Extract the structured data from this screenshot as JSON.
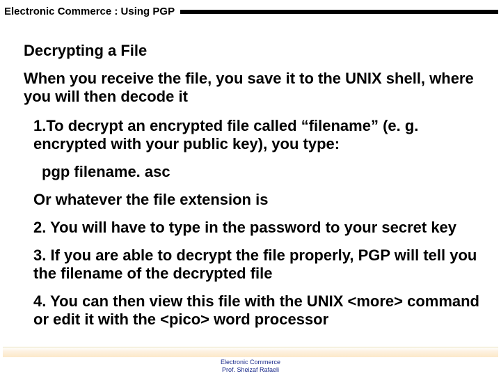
{
  "header": {
    "title": "Electronic Commerce :  Using PGP"
  },
  "body": {
    "heading": "Decrypting a File",
    "intro": "When you receive the file, you save it to the UNIX shell, where you will then decode it",
    "steps": [
      "1.To decrypt an encrypted file called “filename” (e. g. encrypted with your public key), you type:",
      "2. You will have to type in the password to your secret key",
      "3. If you are able to decrypt the file properly, PGP will tell you the filename of the decrypted file",
      "4. You can then view this file with the UNIX <more> command or edit it with the <pico> word processor"
    ],
    "command": "pgp filename. asc",
    "command_note": "Or whatever the file extension is"
  },
  "footer": {
    "line1": "Electronic Commerce",
    "line2": "Prof. Sheizaf Rafaeli"
  }
}
